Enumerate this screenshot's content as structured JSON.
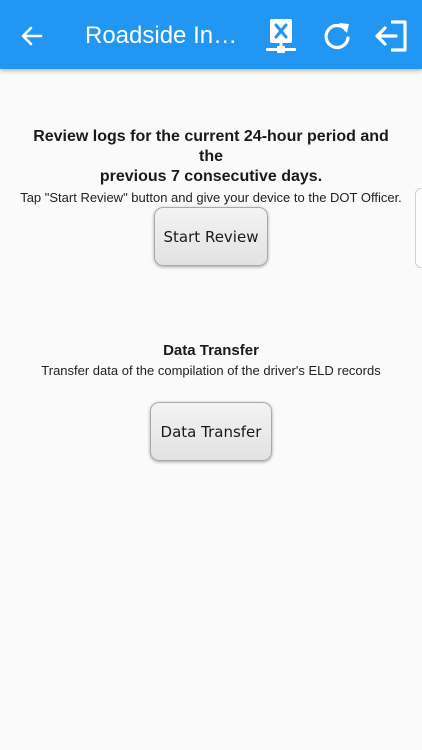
{
  "header": {
    "title": "Roadside Ins…",
    "back_icon": "arrow-left-icon",
    "actions": [
      {
        "name": "network-disconnected-icon"
      },
      {
        "name": "refresh-icon"
      },
      {
        "name": "logout-icon"
      }
    ],
    "color": "#2196f3"
  },
  "review": {
    "heading_line1": "Review logs for the current 24-hour period and the",
    "heading_line2": "previous 7 consecutive days.",
    "instructions": "Tap \"Start Review\" button and give your device to the DOT Officer.",
    "button_label": "Start Review"
  },
  "transfer": {
    "heading": "Data Transfer",
    "description": "Transfer data of the compilation of the driver's ELD records",
    "button_label": "Data Transfer"
  }
}
